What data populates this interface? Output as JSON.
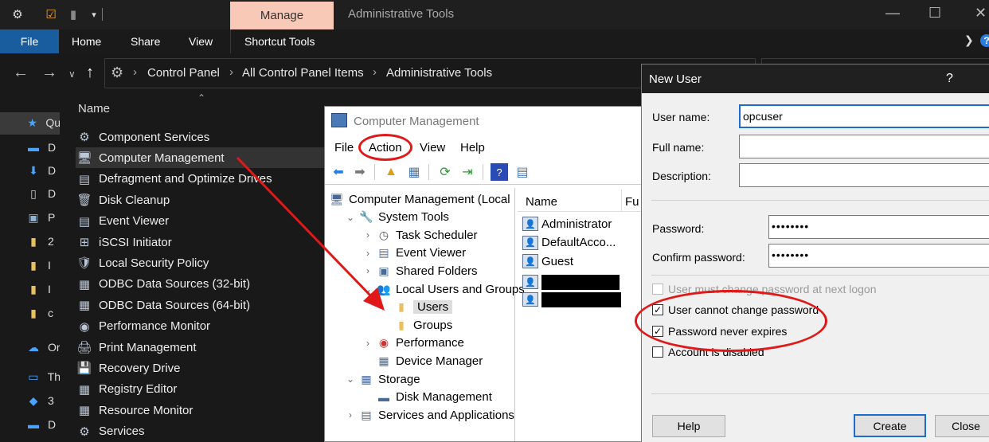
{
  "explorer": {
    "title": "Administrative Tools",
    "context_tab": "Manage",
    "ribbon_tabs": [
      "File",
      "Home",
      "Share",
      "View",
      "Shortcut Tools"
    ],
    "breadcrumb": [
      "Control Panel",
      "All Control Panel Items",
      "Administrative Tools"
    ],
    "column_header": "Name",
    "nav_items": [
      {
        "icon": "star-icon",
        "label": "Qu"
      },
      {
        "icon": "desktop-icon",
        "label": "D"
      },
      {
        "icon": "download-icon",
        "label": "D"
      },
      {
        "icon": "document-icon",
        "label": "D"
      },
      {
        "icon": "pictures-icon",
        "label": "P"
      },
      {
        "icon": "folder-icon",
        "label": "2"
      },
      {
        "icon": "folder-icon",
        "label": "I"
      },
      {
        "icon": "folder-icon",
        "label": "I"
      },
      {
        "icon": "folder-icon",
        "label": "c"
      },
      {
        "icon": "cloud-icon",
        "label": "Or"
      },
      {
        "icon": "pc-icon",
        "label": "Th"
      },
      {
        "icon": "cube-icon",
        "label": "3"
      },
      {
        "icon": "desktop-icon",
        "label": "D"
      }
    ],
    "files": [
      "Component Services",
      "Computer Management",
      "Defragment and Optimize Drives",
      "Disk Cleanup",
      "Event Viewer",
      "iSCSI Initiator",
      "Local Security Policy",
      "ODBC Data Sources (32-bit)",
      "ODBC Data Sources (64-bit)",
      "Performance Monitor",
      "Print Management",
      "Recovery Drive",
      "Registry Editor",
      "Resource Monitor",
      "Services"
    ],
    "selected_file": "Computer Management"
  },
  "computer_management": {
    "title": "Computer Management",
    "menu": [
      "File",
      "Action",
      "View",
      "Help"
    ],
    "tree": [
      {
        "label": "Computer Management (Local",
        "level": 0,
        "twisty": "",
        "icon": "computer-icon"
      },
      {
        "label": "System Tools",
        "level": 1,
        "twisty": "v",
        "icon": "tools-icon"
      },
      {
        "label": "Task Scheduler",
        "level": 2,
        "twisty": ">",
        "icon": "clock-icon"
      },
      {
        "label": "Event Viewer",
        "level": 2,
        "twisty": ">",
        "icon": "event-icon"
      },
      {
        "label": "Shared Folders",
        "level": 2,
        "twisty": ">",
        "icon": "shared-folder-icon"
      },
      {
        "label": "Local Users and Groups",
        "level": 2,
        "twisty": "v",
        "icon": "users-icon"
      },
      {
        "label": "Users",
        "level": 3,
        "twisty": "",
        "icon": "folder-icon",
        "selected": true
      },
      {
        "label": "Groups",
        "level": 3,
        "twisty": "",
        "icon": "folder-icon"
      },
      {
        "label": "Performance",
        "level": 2,
        "twisty": ">",
        "icon": "performance-icon"
      },
      {
        "label": "Device Manager",
        "level": 2,
        "twisty": "",
        "icon": "device-icon"
      },
      {
        "label": "Storage",
        "level": 1,
        "twisty": "v",
        "icon": "storage-icon"
      },
      {
        "label": "Disk Management",
        "level": 2,
        "twisty": "",
        "icon": "disk-icon"
      },
      {
        "label": "Services and Applications",
        "level": 1,
        "twisty": ">",
        "icon": "services-icon"
      }
    ],
    "list_columns": [
      "Name",
      "Fu"
    ],
    "users": [
      "Administrator",
      "DefaultAcco...",
      "Guest"
    ]
  },
  "new_user": {
    "title": "New User",
    "help": "?",
    "fields": {
      "username_label": "User name:",
      "username_value": "opcuser",
      "fullname_label": "Full name:",
      "fullname_value": "",
      "description_label": "Description:",
      "description_value": "",
      "password_label": "Password:",
      "password_value": "••••••••",
      "confirm_label": "Confirm password:",
      "confirm_value": "••••••••"
    },
    "options": [
      {
        "label": "User must change password at next logon",
        "checked": false,
        "disabled": true
      },
      {
        "label": "User cannot change password",
        "checked": true,
        "disabled": false
      },
      {
        "label": "Password never expires",
        "checked": true,
        "disabled": false
      },
      {
        "label": "Account is disabled",
        "checked": false,
        "disabled": false
      }
    ],
    "buttons": {
      "help": "Help",
      "create": "Create",
      "close": "Close"
    }
  },
  "colors": {
    "accent": "#1a5d9e",
    "annotation": "#e01818",
    "manage_tab": "#f8c9b7"
  }
}
